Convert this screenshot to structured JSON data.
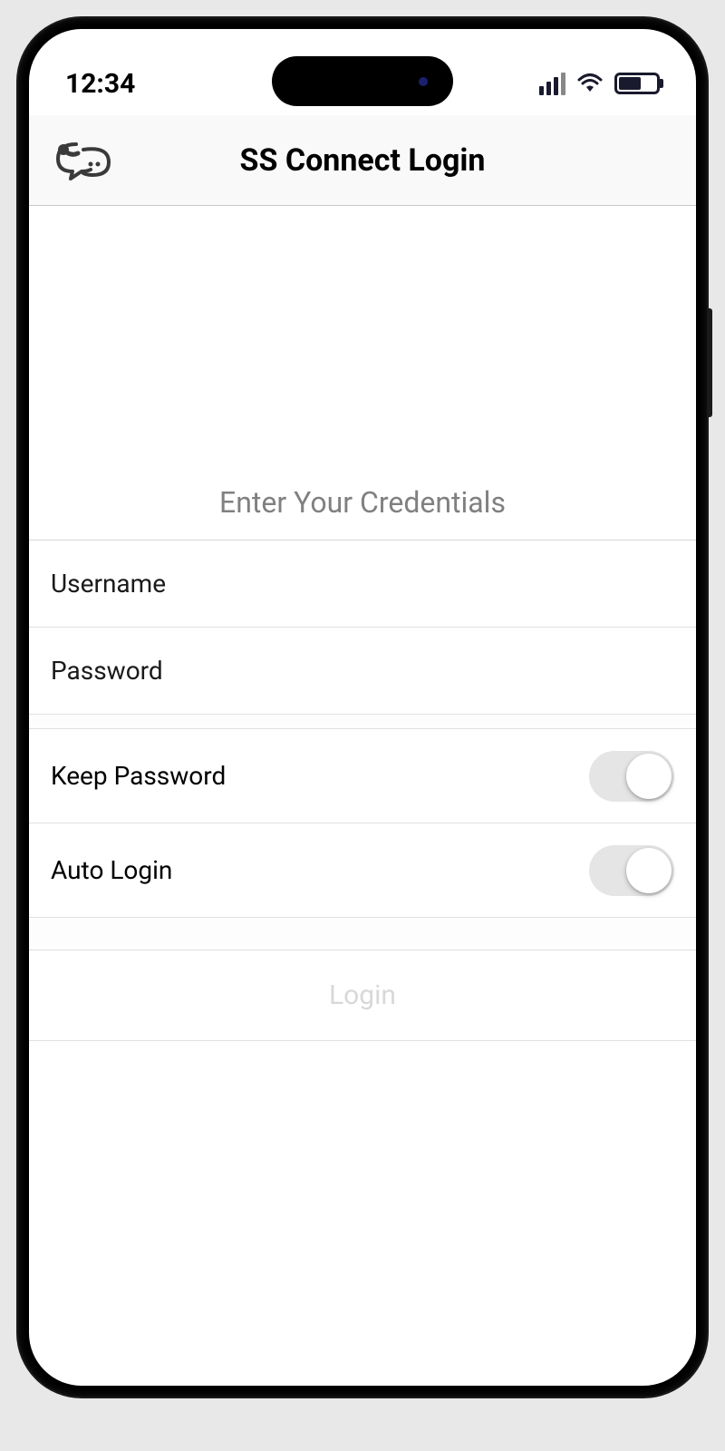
{
  "status_bar": {
    "time": "12:34"
  },
  "header": {
    "title": "SS Connect Login"
  },
  "form": {
    "section_title": "Enter Your Credentials",
    "username_placeholder": "Username",
    "username_value": "",
    "password_placeholder": "Password",
    "password_value": "",
    "keep_password_label": "Keep Password",
    "keep_password_on": false,
    "auto_login_label": "Auto Login",
    "auto_login_on": false,
    "login_button_label": "Login"
  }
}
